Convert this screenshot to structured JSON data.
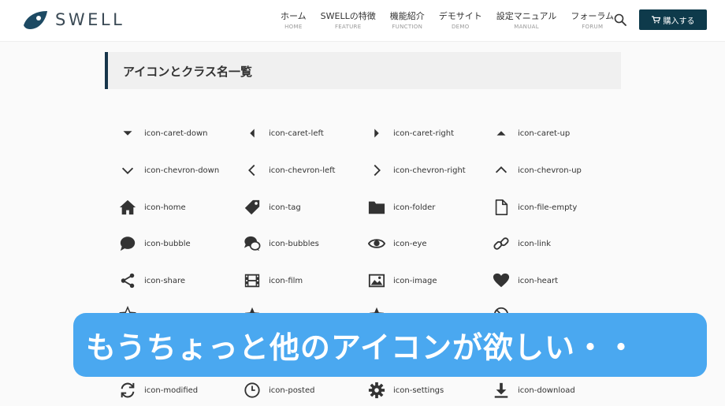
{
  "header": {
    "logo_text": "SWELL",
    "nav": [
      {
        "jp": "ホーム",
        "en": "HOME"
      },
      {
        "jp": "SWELLの特徴",
        "en": "FEATURE"
      },
      {
        "jp": "機能紹介",
        "en": "FUNCTION"
      },
      {
        "jp": "デモサイト",
        "en": "DEMO"
      },
      {
        "jp": "設定マニュアル",
        "en": "MANUAL"
      },
      {
        "jp": "フォーラム",
        "en": "FORUM"
      }
    ],
    "buy_label": "購入する"
  },
  "section": {
    "title": "アイコンとクラス名一覧"
  },
  "icons": [
    {
      "name": "caret-down-icon",
      "label": "icon-caret-down"
    },
    {
      "name": "caret-left-icon",
      "label": "icon-caret-left"
    },
    {
      "name": "caret-right-icon",
      "label": "icon-caret-right"
    },
    {
      "name": "caret-up-icon",
      "label": "icon-caret-up"
    },
    {
      "name": "chevron-down-icon",
      "label": "icon-chevron-down"
    },
    {
      "name": "chevron-left-icon",
      "label": "icon-chevron-left"
    },
    {
      "name": "chevron-right-icon",
      "label": "icon-chevron-right"
    },
    {
      "name": "chevron-up-icon",
      "label": "icon-chevron-up"
    },
    {
      "name": "home-icon",
      "label": "icon-home"
    },
    {
      "name": "tag-icon",
      "label": "icon-tag"
    },
    {
      "name": "folder-icon",
      "label": "icon-folder"
    },
    {
      "name": "file-empty-icon",
      "label": "icon-file-empty"
    },
    {
      "name": "bubble-icon",
      "label": "icon-bubble"
    },
    {
      "name": "bubbles-icon",
      "label": "icon-bubbles"
    },
    {
      "name": "eye-icon",
      "label": "icon-eye"
    },
    {
      "name": "link-icon",
      "label": "icon-link"
    },
    {
      "name": "share-icon",
      "label": "icon-share"
    },
    {
      "name": "film-icon",
      "label": "icon-film"
    },
    {
      "name": "image-icon",
      "label": "icon-image"
    },
    {
      "name": "heart-icon",
      "label": "icon-heart"
    },
    {
      "name": "modified-icon",
      "label": "icon-modified"
    },
    {
      "name": "posted-icon",
      "label": "icon-posted"
    },
    {
      "name": "settings-icon",
      "label": "icon-settings"
    },
    {
      "name": "download-icon",
      "label": "icon-download"
    }
  ],
  "banner": {
    "text": "もうちょっと他のアイコンが欲しい・・"
  },
  "colors": {
    "brand": "#0e3a4b",
    "banner": "#4aa8f0",
    "icon": "#333333"
  }
}
